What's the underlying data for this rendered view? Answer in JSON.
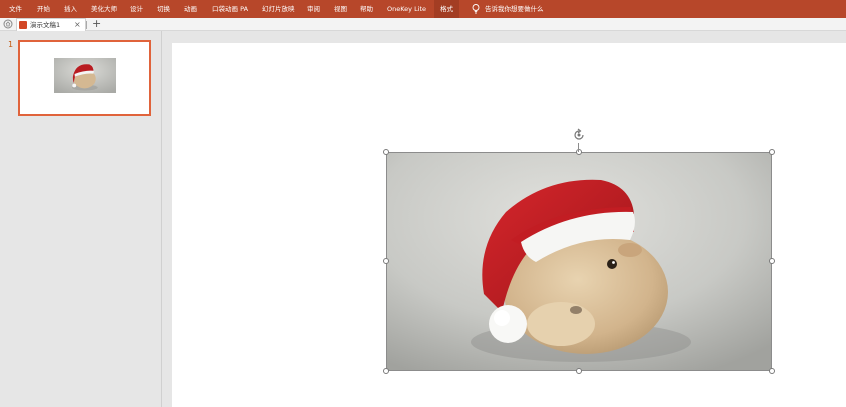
{
  "ribbon": {
    "tabs": [
      "文件",
      "开始",
      "插入",
      "美化大师",
      "设计",
      "切换",
      "动画",
      "口袋动画 PA",
      "幻灯片放映",
      "审阅",
      "视图",
      "帮助",
      "OneKey Lite",
      "格式"
    ],
    "active_tab": "格式",
    "tell_me": "告诉我你想要做什么",
    "accent_color": "#b7472a"
  },
  "document": {
    "tab_title": "演示文稿1",
    "close_glyph": "×",
    "add_glyph": "+"
  },
  "thumbnails": {
    "slide_number": "1"
  },
  "canvas": {
    "picture_subject": "guinea pig wearing a santa hat",
    "selection_color": "#8c8c8c"
  }
}
